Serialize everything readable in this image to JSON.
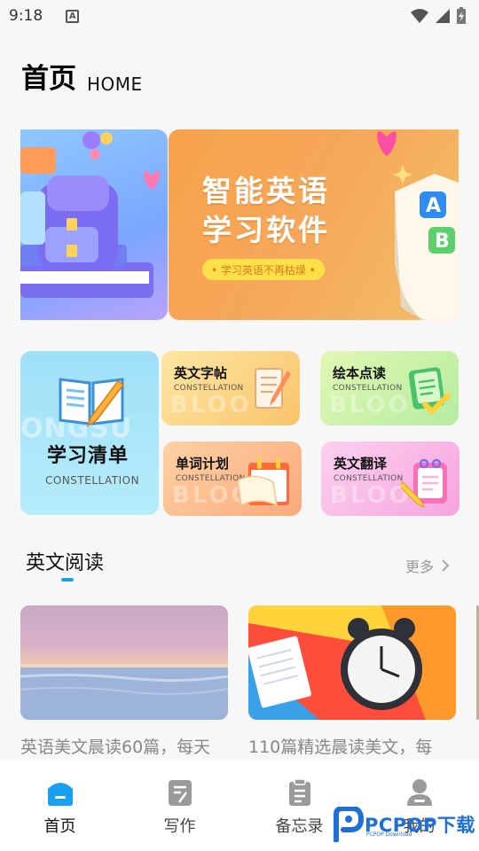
{
  "status_bar": {
    "time": "9:18",
    "badge": "A"
  },
  "header": {
    "title": "首页",
    "subtitle": "HOME"
  },
  "banner": {
    "title": "智能英语学习软件",
    "tagline": "• 学习英语不再枯燥 •"
  },
  "features": {
    "study": {
      "title": "学习清单",
      "subtitle": "CONSTELLATION",
      "bg_word": "ONGSU"
    },
    "items": [
      {
        "title": "英文字帖",
        "subtitle": "CONSTELLATION",
        "bg_word": "BLOO"
      },
      {
        "title": "绘本点读",
        "subtitle": "CONSTELLATION",
        "bg_word": "BLOO"
      },
      {
        "title": "单词计划",
        "subtitle": "CONSTELLATION",
        "bg_word": "BLOO"
      },
      {
        "title": "英文翻译",
        "subtitle": "CONSTELLATION",
        "bg_word": "BLOO"
      }
    ]
  },
  "reading": {
    "title": "英文阅读",
    "more": "更多",
    "articles": [
      {
        "text": "英语美文晨读60篇，每天"
      },
      {
        "text": "110篇精选晨读美文，每"
      }
    ]
  },
  "nav": {
    "items": [
      {
        "label": "首页",
        "active": true
      },
      {
        "label": "写作",
        "active": false
      },
      {
        "label": "备忘录",
        "active": false
      },
      {
        "label": "我的",
        "active": false
      }
    ]
  },
  "watermark": {
    "text": "PCPOP下载",
    "small": "PCPOP Download"
  },
  "colors": {
    "accent": "#1aa0f0",
    "banner_orange": "#f7a24a",
    "active_nav": "#1aa0f0",
    "inactive_nav": "#9a9a9a"
  }
}
